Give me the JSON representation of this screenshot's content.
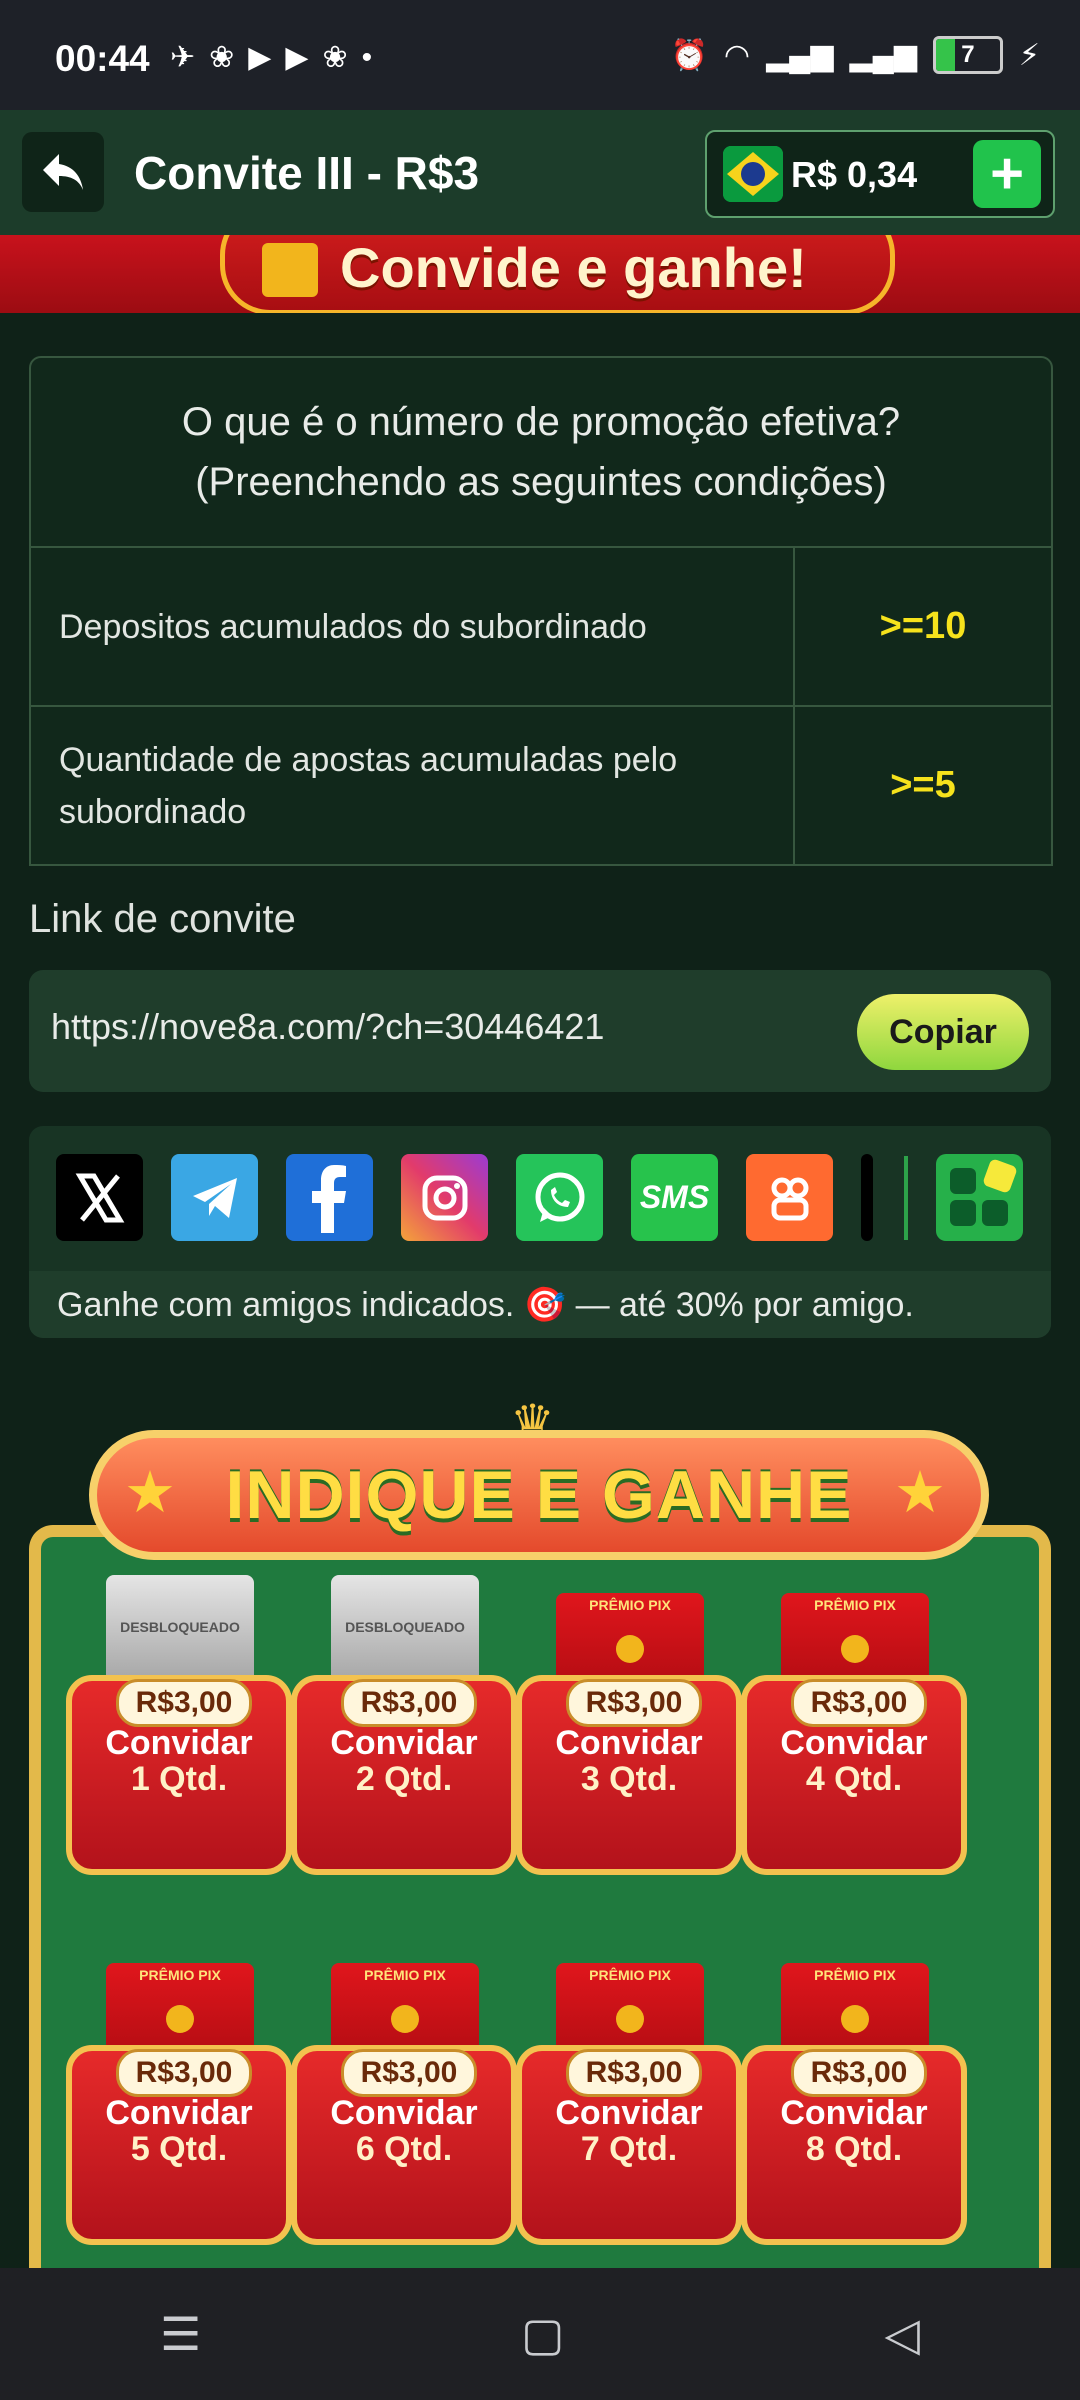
{
  "status_bar": {
    "time": "00:44",
    "battery": "7"
  },
  "header": {
    "title": "Convite III - R$3",
    "balance": "R$ 0,34",
    "plus_label": "+"
  },
  "banner": {
    "text": "Convide e ganhe!"
  },
  "conditions": {
    "heading_line1": "O que é o número de promoção efetiva?",
    "heading_line2": "(Preenchendo as seguintes condições)",
    "rows": [
      {
        "label": "Depositos acumulados do subordinado",
        "value": ">=10"
      },
      {
        "label": "Quantidade de apostas acumuladas pelo subordinado",
        "value": ">=5"
      }
    ]
  },
  "invite": {
    "section_title": "Link de convite",
    "url": "https://nove8a.com/?ch=30446421",
    "copy_label": "Copiar"
  },
  "share": {
    "icons": [
      "x-icon",
      "telegram-icon",
      "facebook-icon",
      "instagram-icon",
      "whatsapp-icon",
      "sms-icon",
      "kwai-icon"
    ],
    "sms_label": "SMS",
    "note": "Ganhe com amigos indicados. 🎯 — até 30% por amigo."
  },
  "promo": {
    "title": "INDIQUE E GANHE",
    "envelope_locked_label": "DESBLOQUEADO",
    "envelope_pix_label": "PRÊMIO PIX",
    "cards": [
      {
        "price": "R$3,00",
        "action": "Convidar",
        "qty": "1 Qtd.",
        "state": "locked"
      },
      {
        "price": "R$3,00",
        "action": "Convidar",
        "qty": "2 Qtd.",
        "state": "locked"
      },
      {
        "price": "R$3,00",
        "action": "Convidar",
        "qty": "3 Qtd.",
        "state": "pix"
      },
      {
        "price": "R$3,00",
        "action": "Convidar",
        "qty": "4 Qtd.",
        "state": "pix"
      },
      {
        "price": "R$3,00",
        "action": "Convidar",
        "qty": "5 Qtd.",
        "state": "pix"
      },
      {
        "price": "R$3,00",
        "action": "Convidar",
        "qty": "6 Qtd.",
        "state": "pix"
      },
      {
        "price": "R$3,00",
        "action": "Convidar",
        "qty": "7 Qtd.",
        "state": "pix"
      },
      {
        "price": "R$3,00",
        "action": "Convidar",
        "qty": "8 Qtd.",
        "state": "pix"
      }
    ]
  },
  "colors": {
    "accent_yellow": "#f6e21c",
    "header_green": "#1c3c2a",
    "banner_red": "#c8121c"
  }
}
